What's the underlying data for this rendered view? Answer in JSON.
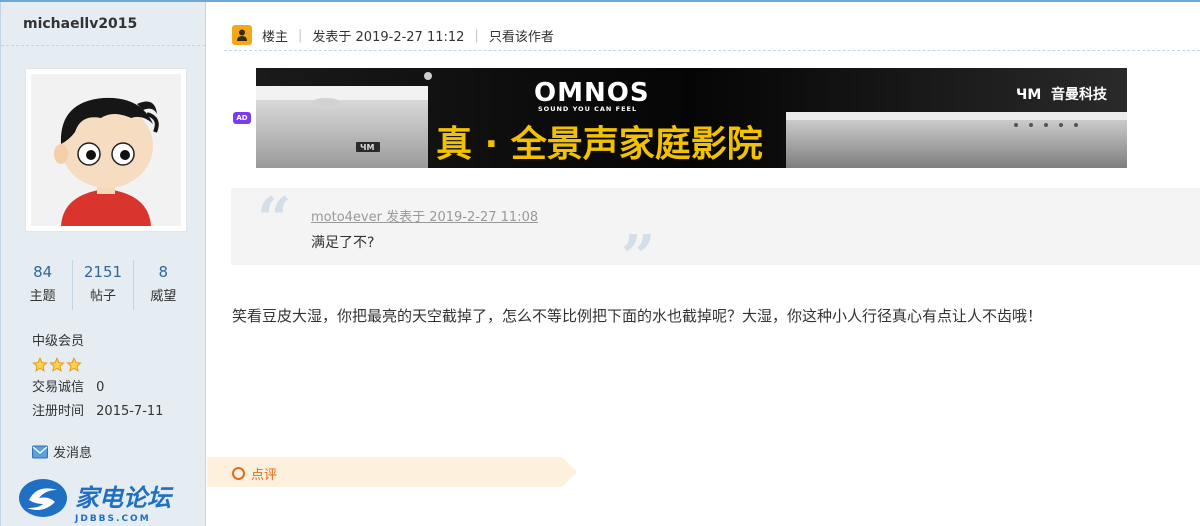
{
  "user": {
    "name": "michaellv2015",
    "stats": [
      {
        "num": "84",
        "label": "主题"
      },
      {
        "num": "2151",
        "label": "帖子"
      },
      {
        "num": "8",
        "label": "威望"
      }
    ],
    "rank": "中级会员",
    "star_count": 3,
    "trade_label": "交易诚信",
    "trade_value": "0",
    "reg_label": "注册时间",
    "reg_value": "2015-7-11",
    "send_msg": "发消息"
  },
  "site_logo": {
    "text": "家电论坛",
    "domain": "JDBBS.COM"
  },
  "post": {
    "role": "楼主",
    "posted": "发表于 2019-2-27 11:12",
    "only_author": "只看该作者",
    "ad_tag": "AD",
    "banner": {
      "brand": "OMNOS",
      "slogan": "SOUND YOU CAN FEEL",
      "headline": "真 · 全景声家庭影院",
      "company": "音曼科技",
      "company_mark": "ЧМ",
      "device_mark": "ЧМ"
    },
    "quote": {
      "author": "moto4ever 发表于 2019-2-27 11:08",
      "text": "满足了不?"
    },
    "content": "笑看豆皮大湿，你把最亮的天空截掉了，怎么不等比例把下面的水也截掉呢？大湿，你这种小人行径真心有点让人不齿哦！",
    "comment_label": "点评"
  },
  "colors": {
    "sidebar_bg": "#e5edf2",
    "link_blue": "#336699",
    "accent_orange": "#e06c1a",
    "banner_gold": "#f2c200"
  }
}
